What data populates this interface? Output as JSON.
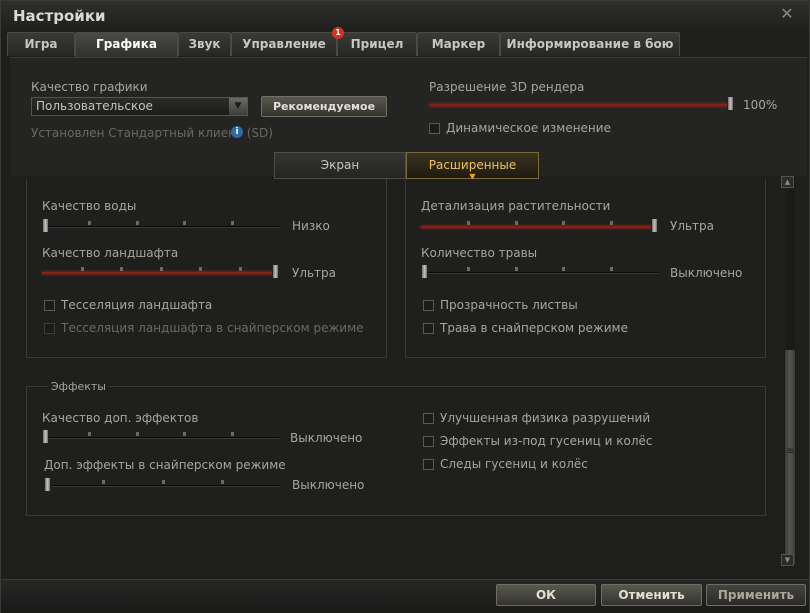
{
  "window": {
    "title": "Настройки",
    "close_symbol": "✕"
  },
  "tabs": [
    {
      "label": "Игра",
      "active": false
    },
    {
      "label": "Графика",
      "active": true
    },
    {
      "label": "Звук",
      "active": false
    },
    {
      "label": "Управление",
      "active": false,
      "badge": "1"
    },
    {
      "label": "Прицел",
      "active": false
    },
    {
      "label": "Маркер",
      "active": false
    },
    {
      "label": "Информирование в бою",
      "active": false
    }
  ],
  "top": {
    "quality_label": "Качество графики",
    "quality_value": "Пользовательское",
    "recommended_button": "Рекомендуемое",
    "client_note": "Установлен Стандартный клиент (SD)",
    "info_icon": "i",
    "resolution_label": "Разрешение 3D рендера",
    "resolution_value": "100%",
    "resolution_level": 1.0,
    "dynamic_change": "Динамическое изменение"
  },
  "subtabs": [
    {
      "label": "Экран",
      "active": false
    },
    {
      "label": "Расширенные",
      "active": true
    }
  ],
  "left_group": {
    "water_label": "Качество воды",
    "water_value": "Низко",
    "water_level": 0.0,
    "landscape_label": "Качество ландшафта",
    "landscape_value": "Ультра",
    "landscape_level": 1.0,
    "tessellation": "Тесселяция ландшафта",
    "tessellation_sniper": "Тесселяция ландшафта в снайперском режиме"
  },
  "right_group": {
    "vegetation_label": "Детализация растительности",
    "vegetation_value": "Ультра",
    "vegetation_level": 1.0,
    "grass_label": "Количество травы",
    "grass_value": "Выключено",
    "grass_level": 0.0,
    "foliage_transparency": "Прозрачность листвы",
    "grass_sniper": "Трава в снайперском режиме"
  },
  "effects_group": {
    "title": "Эффекты",
    "extra_effects_label": "Качество доп. эффектов",
    "extra_effects_value": "Выключено",
    "extra_effects_level": 0.0,
    "sniper_effects_label": "Доп. эффекты в снайперском режиме",
    "sniper_effects_value": "Выключено",
    "sniper_effects_level": 0.0,
    "physics": "Улучшенная физика разрушений",
    "track_effects": "Эффекты из-под гусениц и колёс",
    "track_marks": "Следы гусениц и колёс"
  },
  "footer": {
    "ok": "ОК",
    "cancel": "Отменить",
    "apply": "Применить"
  },
  "scrollbar": {
    "grip_symbol": "≡",
    "up_symbol": "▲",
    "down_symbol": "▼"
  }
}
